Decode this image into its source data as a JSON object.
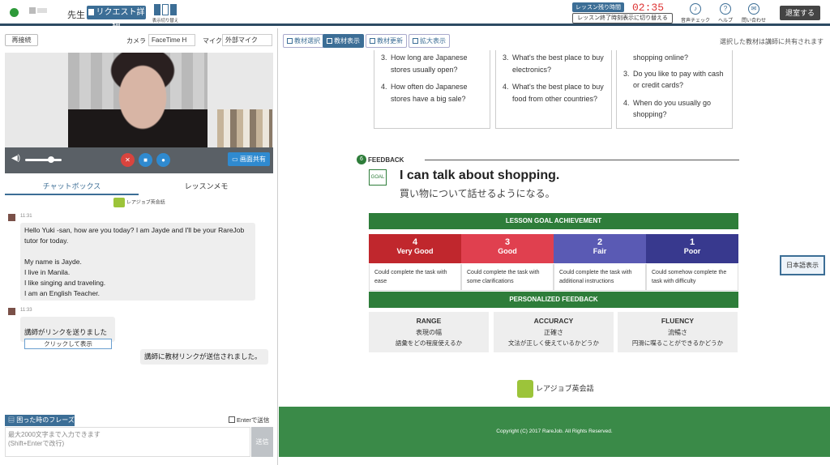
{
  "header": {
    "teacher_label": "先生",
    "request_button": "リクエスト詳細",
    "layout_switch": "表示切り替え",
    "timer_label": "レッスン残り時間",
    "timer_value": "02:35",
    "timer_toggle": "レッスン終了時刻表示に切り替える",
    "audio_check": "音声チェック",
    "help": "ヘルプ",
    "contact": "問い合わせ",
    "exit_button": "退室する"
  },
  "video": {
    "reconnect": "再接続",
    "camera_label": "カメラ",
    "camera_value": "FaceTime H",
    "mic_label": "マイク",
    "mic_value": "外部マイク",
    "share_screen": "画面共有",
    "volume": 0.72
  },
  "tabs": [
    "チャットボックス",
    "レッスンメモ"
  ],
  "chat": {
    "logo_text": "レアジョブ英会話",
    "messages": [
      {
        "time": "11:31",
        "text": "Hello Yuki -san, how are you today? I am Jayde and I'll be your RareJob tutor for today.\n\nMy name is Jayde.\nI live in Manila.\nI like singing and traveling.\nI am an English Teacher."
      },
      {
        "time": "11:33",
        "text": "講師がリンクを送りました",
        "link": "クリックして表示"
      },
      {
        "text": "講師に教材リンクが送信されました。"
      }
    ],
    "phrase_tag": "困った時のフレーズ",
    "enter_send": "Enterで送信",
    "placeholder": "最大2000文字まで入力できます\n(Shift+Enterで改行)",
    "send": "送信"
  },
  "material": {
    "buttons": [
      "教材選択",
      "教材表示",
      "教材更新",
      "拡大表示"
    ],
    "share_note": "選択した教材は講師に共有されます",
    "columns": [
      [
        {
          "n": "3.",
          "t": "How long are Japanese stores usually open?"
        },
        {
          "n": "4.",
          "t": "How often do Japanese stores have a big sale?"
        }
      ],
      [
        {
          "n": "3.",
          "t": "What's the best place to buy electronics?"
        },
        {
          "n": "4.",
          "t": "What's the best place to buy food from other countries?"
        }
      ],
      [
        {
          "n": "",
          "t": "shopping online?"
        },
        {
          "n": "3.",
          "t": "Do you like to pay with cash or credit cards?"
        },
        {
          "n": "4.",
          "t": "When do you usually go shopping?"
        }
      ]
    ],
    "feedback_num": "6",
    "feedback_title": "FEEDBACK",
    "goal_badge": "GOAL",
    "goal_en": "I can talk about shopping.",
    "goal_ja": "買い物について話せるようになる。",
    "achievement_title": "LESSON GOAL ACHIEVEMENT",
    "ratings": [
      {
        "num": "4",
        "word": "Very Good",
        "color": "#c0272d",
        "desc": "Could complete the task with ease"
      },
      {
        "num": "3",
        "word": "Good",
        "color": "#e0404f",
        "desc": "Could complete the task with some clarifications"
      },
      {
        "num": "2",
        "word": "Fair",
        "color": "#5a5ab4",
        "desc": "Could complete the task with additional instructions"
      },
      {
        "num": "1",
        "word": "Poor",
        "color": "#38398e",
        "desc": "Could somehow complete the task with difficulty"
      }
    ],
    "personalized_title": "PERSONALIZED FEEDBACK",
    "personalized": [
      {
        "title": "RANGE",
        "sub": "表現の幅",
        "desc": "語彙をどの程度使えるか"
      },
      {
        "title": "ACCURACY",
        "sub": "正確さ",
        "desc": "文法が正しく使えているかどうか"
      },
      {
        "title": "FLUENCY",
        "sub": "流暢さ",
        "desc": "円滑に喋ることができるかどうか"
      }
    ],
    "logo_text": "レアジョブ英会話",
    "copyright": "Copyright (C) 2017 RareJob. All Rights Reserved.",
    "jp_toggle": "日本語表示"
  }
}
